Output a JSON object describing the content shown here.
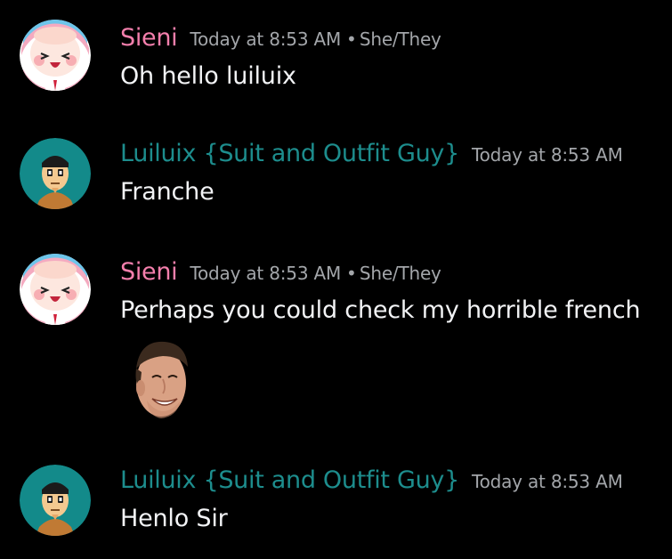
{
  "users": {
    "sieni": {
      "name": "Sieni",
      "color": "#f47fac",
      "pronouns": "She/They",
      "avatar_icon": "anime-face-avatar-icon"
    },
    "luiluix": {
      "name": "Luiluix {Suit and Outfit Guy}",
      "color": "#1d8d8d",
      "avatar_icon": "cartoon-man-avatar-icon"
    }
  },
  "separator": "•",
  "messages": [
    {
      "author": "Sieni",
      "timestamp": "Today at 8:53 AM",
      "pronouns": "She/They",
      "text": "Oh hello luiluix"
    },
    {
      "author": "Luiluix {Suit and Outfit Guy}",
      "timestamp": "Today at 8:53 AM",
      "text": "Franche"
    },
    {
      "author": "Sieni",
      "timestamp": "Today at 8:53 AM",
      "pronouns": "She/They",
      "text": "Perhaps you could check my horrible french",
      "attachment_icon": "laughing-face-emoji-icon"
    },
    {
      "author": "Luiluix {Suit and Outfit Guy}",
      "timestamp": "Today at 8:53 AM",
      "text": "Henlo Sir"
    }
  ]
}
